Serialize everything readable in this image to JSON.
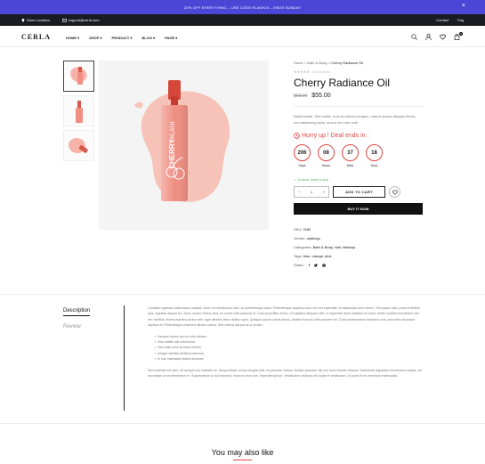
{
  "promo": {
    "text": "20% OFF EVERYTHING – USE CODE:FLASH20 – ENDS SUNDAY",
    "close": "×"
  },
  "topbar": {
    "store": "Store Location",
    "email": "support@cerla.com",
    "contact": "Contact",
    "faq": "Faq"
  },
  "header": {
    "logo": "CERLA",
    "nav": [
      "HOME",
      "SHOP",
      "PRODUCT",
      "BLOG",
      "PAGE"
    ],
    "cart_count": "0"
  },
  "product": {
    "breadcrumb": {
      "home": "Home",
      "sep": ">",
      "cat": "Bath & Body",
      "current": "Cherry Radiance Oil"
    },
    "reviews": "No reviews",
    "title": "Cherry Radiance Oil",
    "old_price": "$58.00",
    "price": "$55.00",
    "description": "Nulla facilisi. Sed mollis, eros et ultrices tempus, mauris ipsum aliquam libero, non adipiscing dolor urna a orci non velit.",
    "hurry": "Hurry up ! Deal ends in :",
    "timer": [
      {
        "value": "206",
        "label": "Days"
      },
      {
        "value": "08",
        "label": "Hours"
      },
      {
        "value": "37",
        "label": "Mins"
      },
      {
        "value": "18",
        "label": "Secs"
      }
    ],
    "stock": "In stock, ready to ship",
    "qty": "1",
    "qty_minus": "−",
    "qty_plus": "+",
    "add_to_cart": "ADD TO CART",
    "buy_now": "BUY IT NOW",
    "sku_label": "SKU:",
    "sku": "0182",
    "vendor_label": "Vendor:",
    "vendor": "wpbingo",
    "categories_label": "Categories:",
    "categories": "Bath & Body, Hair, Makeup",
    "tags_label": "Tags:",
    "tags": "blue, orange, pink",
    "share_label": "Share:"
  },
  "tabs": {
    "description": "Description",
    "review": "Review"
  },
  "content": {
    "p1": "Curabitur egestas malesuada volutpat. Nunc vel vestibulum odio, ac pellentesque lacus. Pellentesque dapibus nunc nec est imperdiet, a malesuada sem rutrum. Sed quam odio, porta id finibus quis, egestas aliquet leo. Nunc ornare metus urna, eu luctus velit placerat ut. Cras at porttitor lectus. Ut dapibus aliquam nibh, in imperdiet diam tincidunt sit amet. Morbi sodales fermentum nisl nec facilisis. Morbi pharetra varius velit, eget ultricies libero finibus quis. Quisque auctor varius lectus, lacinia rhoncus velit posuere vel. Cras condimentum tincidunt urna, sed vehicula ipsum dapibus et. Pellentesque pharetra ultrices varius. Sed viverra nisi purus ut ornare.",
    "bullets": [
      "Aenean auctor wisi et urna ultrices",
      "Non mattis odio bibendum",
      "Sed vitae enim at tortor finibus",
      "Integer facilisis eleifend vehicula",
      "In hac habitasse platea dictumst"
    ],
    "p2": "Sed molestie est sem, sit semper est molestie ac. Suspendisse cursus feugiat erat, eu posuere massa. Nullam posuere nisl non eros lobortis tempus. Maecenas dignissim elementum massa, vel accumsan urna elementum in. Suspendisse at dui euismod, rhoncus eros non, imperdiet ipsum. Vestibulum vehicula vel turpis et vestibulum. Ut porta et ex maximus malesuada."
  },
  "also": "You may also like",
  "colors": {
    "accent": "#e24343",
    "promo": "#4a46d6",
    "topbar": "#1b1b22",
    "product": "#f4a99c"
  }
}
